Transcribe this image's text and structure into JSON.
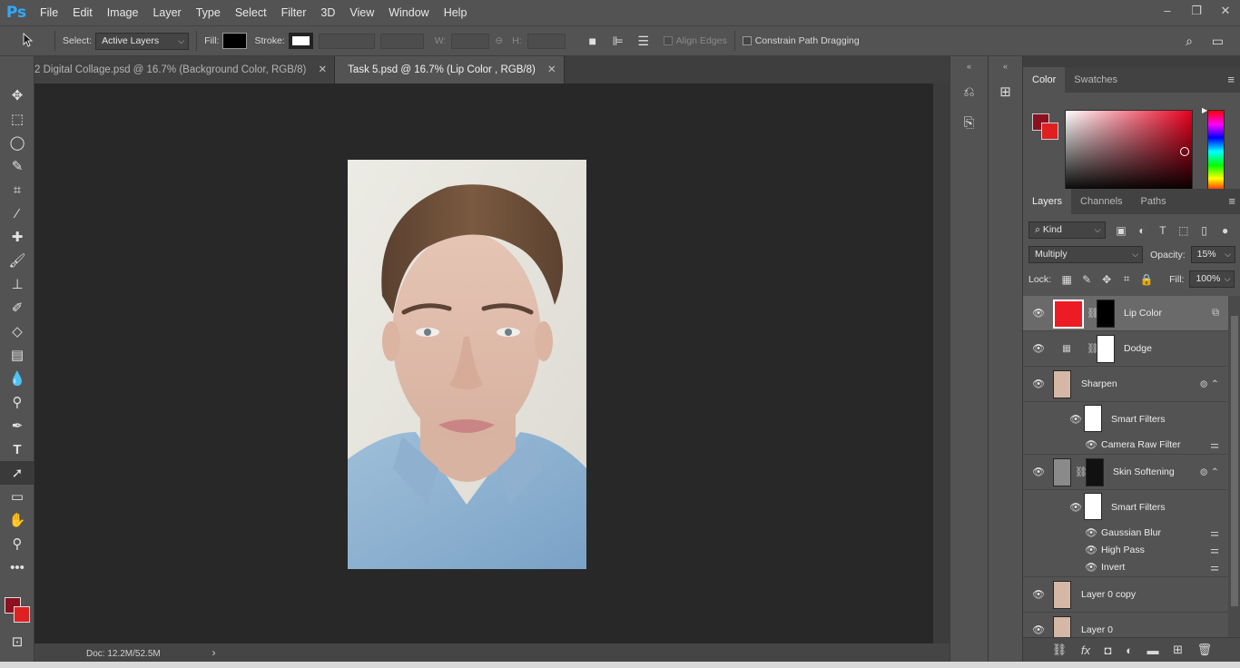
{
  "app": {
    "logo": "Ps",
    "menu": [
      "File",
      "Edit",
      "Image",
      "Layer",
      "Type",
      "Select",
      "Filter",
      "3D",
      "View",
      "Window",
      "Help"
    ],
    "window_controls": [
      "–",
      "❐",
      "✕"
    ]
  },
  "options_bar": {
    "select_label": "Select:",
    "select_value": "Active Layers",
    "fill_label": "Fill:",
    "stroke_label": "Stroke:",
    "w_label": "W:",
    "h_label": "H:",
    "align_edges_label": "Align Edges",
    "constrain_label": "Constrain Path Dragging"
  },
  "doc_tabs": [
    {
      "title": "2 Digital Collage.psd @ 16.7% (Background Color, RGB/8)",
      "close": "✕",
      "active": false
    },
    {
      "title": "Task 5.psd @ 16.7% (Lip Color , RGB/8)",
      "close": "✕",
      "active": true
    }
  ],
  "status_bar": {
    "doc_info": "Doc: 12.2M/52.5M",
    "arrow": "›"
  },
  "color_panel": {
    "tabs": [
      "Color",
      "Swatches"
    ],
    "menu_icon": "≡",
    "foreground": "#8b1020",
    "background": "#e02020"
  },
  "layers_panel": {
    "tabs": [
      "Layers",
      "Channels",
      "Paths"
    ],
    "menu_icon": "≡",
    "filter_kind": "Kind",
    "blend_mode": "Multiply",
    "opacity_label": "Opacity:",
    "opacity_value": "15%",
    "lock_label": "Lock:",
    "fill_label": "Fill:",
    "fill_value": "100%",
    "layers": [
      {
        "name": "Lip Color",
        "selected": true
      },
      {
        "name": "Dodge",
        "selected": false
      },
      {
        "name": "Sharpen",
        "selected": false
      },
      {
        "name": "Smart Filters",
        "selected": false
      },
      {
        "name": "Camera Raw Filter",
        "selected": false
      },
      {
        "name": "Skin Softening",
        "selected": false
      },
      {
        "name": "Smart Filters",
        "selected": false
      },
      {
        "name": "Gaussian Blur",
        "selected": false
      },
      {
        "name": "High Pass",
        "selected": false
      },
      {
        "name": "Invert",
        "selected": false
      },
      {
        "name": "Layer 0 copy",
        "selected": false
      },
      {
        "name": "Layer 0",
        "selected": false
      }
    ],
    "lip_color_fill": "#ed1c24",
    "footer_icons": [
      "link-icon",
      "fx-icon",
      "mask-icon",
      "adjustment-icon",
      "folder-icon",
      "new-layer-icon",
      "trash-icon"
    ]
  },
  "toolbar": {
    "tools": [
      "move-tool-icon",
      "marquee-tool-icon",
      "lasso-tool-icon",
      "quick-select-tool-icon",
      "crop-tool-icon",
      "eyedropper-tool-icon",
      "healing-brush-tool-icon",
      "brush-tool-icon",
      "clone-stamp-tool-icon",
      "history-brush-tool-icon",
      "eraser-tool-icon",
      "gradient-tool-icon",
      "blur-tool-icon",
      "dodge-tool-icon",
      "pen-tool-icon",
      "type-tool-icon",
      "path-selection-tool-icon",
      "rectangle-tool-icon",
      "hand-tool-icon",
      "zoom-tool-icon",
      "more-tools-icon"
    ],
    "foreground": "#8b1020",
    "background": "#e02020"
  }
}
